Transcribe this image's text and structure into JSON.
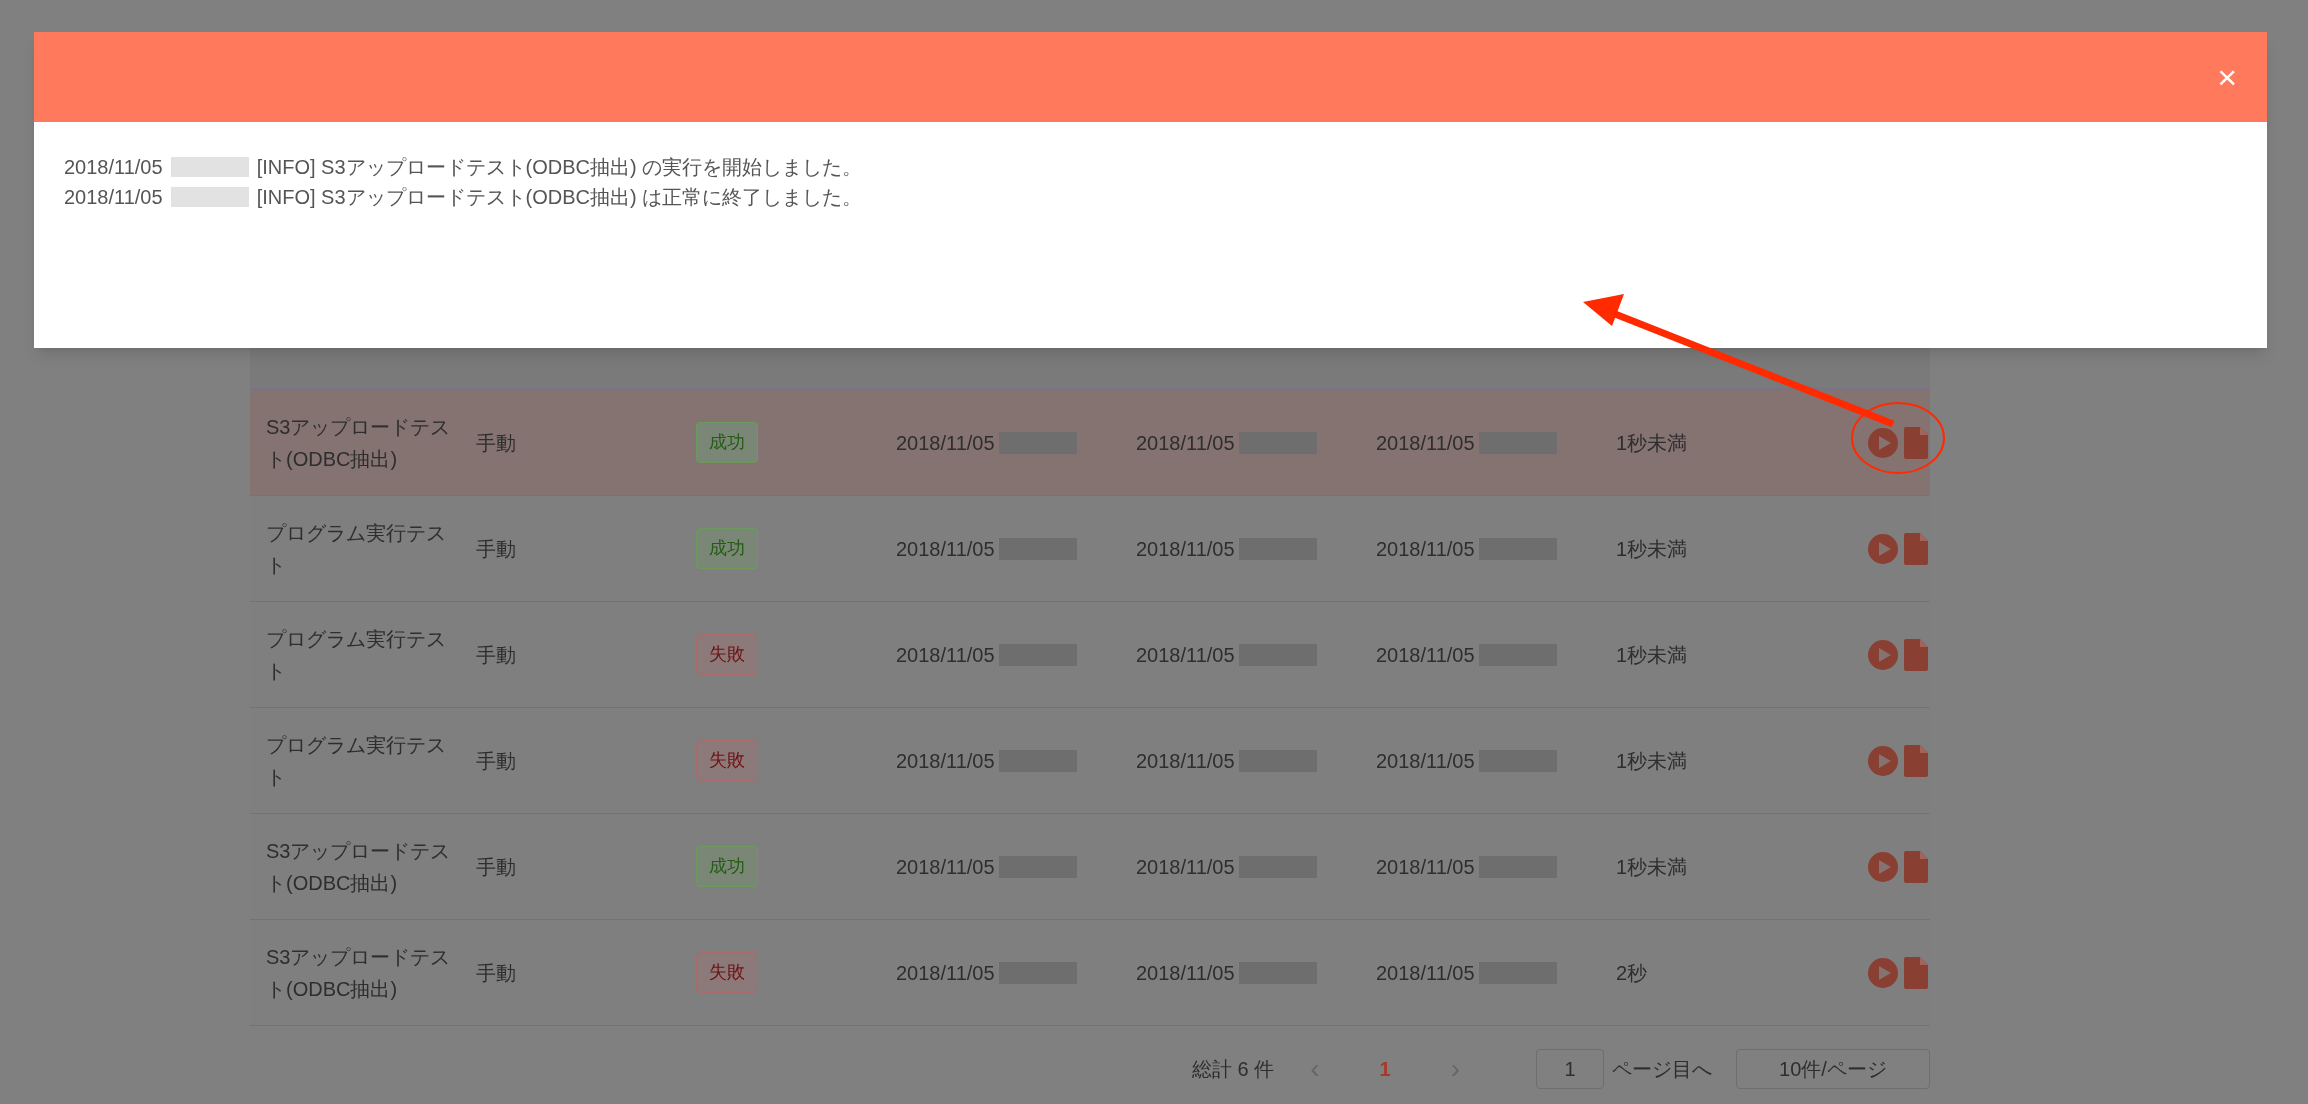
{
  "modal": {
    "log_lines": [
      {
        "date": "2018/11/05",
        "text": "[INFO] S3アップロードテスト(ODBC抽出) の実行を開始しました。"
      },
      {
        "date": "2018/11/05",
        "text": "[INFO] S3アップロードテスト(ODBC抽出) は正常に終了しました。"
      }
    ],
    "close": "×"
  },
  "table": {
    "rows": [
      {
        "name": "S3アップロードテスト(ODBC抽出)",
        "type": "手動",
        "status": {
          "label": "成功",
          "kind": "success"
        },
        "start": "2018/11/05",
        "end": "2018/11/05",
        "updated": "2018/11/05",
        "duration": "1秒未満",
        "selected": true
      },
      {
        "name": "プログラム実行テスト",
        "type": "手動",
        "status": {
          "label": "成功",
          "kind": "success"
        },
        "start": "2018/11/05",
        "end": "2018/11/05",
        "updated": "2018/11/05",
        "duration": "1秒未満",
        "selected": false
      },
      {
        "name": "プログラム実行テスト",
        "type": "手動",
        "status": {
          "label": "失敗",
          "kind": "fail"
        },
        "start": "2018/11/05",
        "end": "2018/11/05",
        "updated": "2018/11/05",
        "duration": "1秒未満",
        "selected": false
      },
      {
        "name": "プログラム実行テスト",
        "type": "手動",
        "status": {
          "label": "失敗",
          "kind": "fail"
        },
        "start": "2018/11/05",
        "end": "2018/11/05",
        "updated": "2018/11/05",
        "duration": "1秒未満",
        "selected": false
      },
      {
        "name": "S3アップロードテスト(ODBC抽出)",
        "type": "手動",
        "status": {
          "label": "成功",
          "kind": "success"
        },
        "start": "2018/11/05",
        "end": "2018/11/05",
        "updated": "2018/11/05",
        "duration": "1秒未満",
        "selected": false
      },
      {
        "name": "S3アップロードテスト(ODBC抽出)",
        "type": "手動",
        "status": {
          "label": "失敗",
          "kind": "fail"
        },
        "start": "2018/11/05",
        "end": "2018/11/05",
        "updated": "2018/11/05",
        "duration": "2秒",
        "selected": false
      }
    ]
  },
  "pagination": {
    "total": "総計 6 件",
    "prev": "‹",
    "pages": [
      {
        "label": "1",
        "selected": true
      }
    ],
    "next": "›",
    "jump_value": "1",
    "jump_label": "ページ目へ",
    "page_size": "10件/ページ"
  }
}
